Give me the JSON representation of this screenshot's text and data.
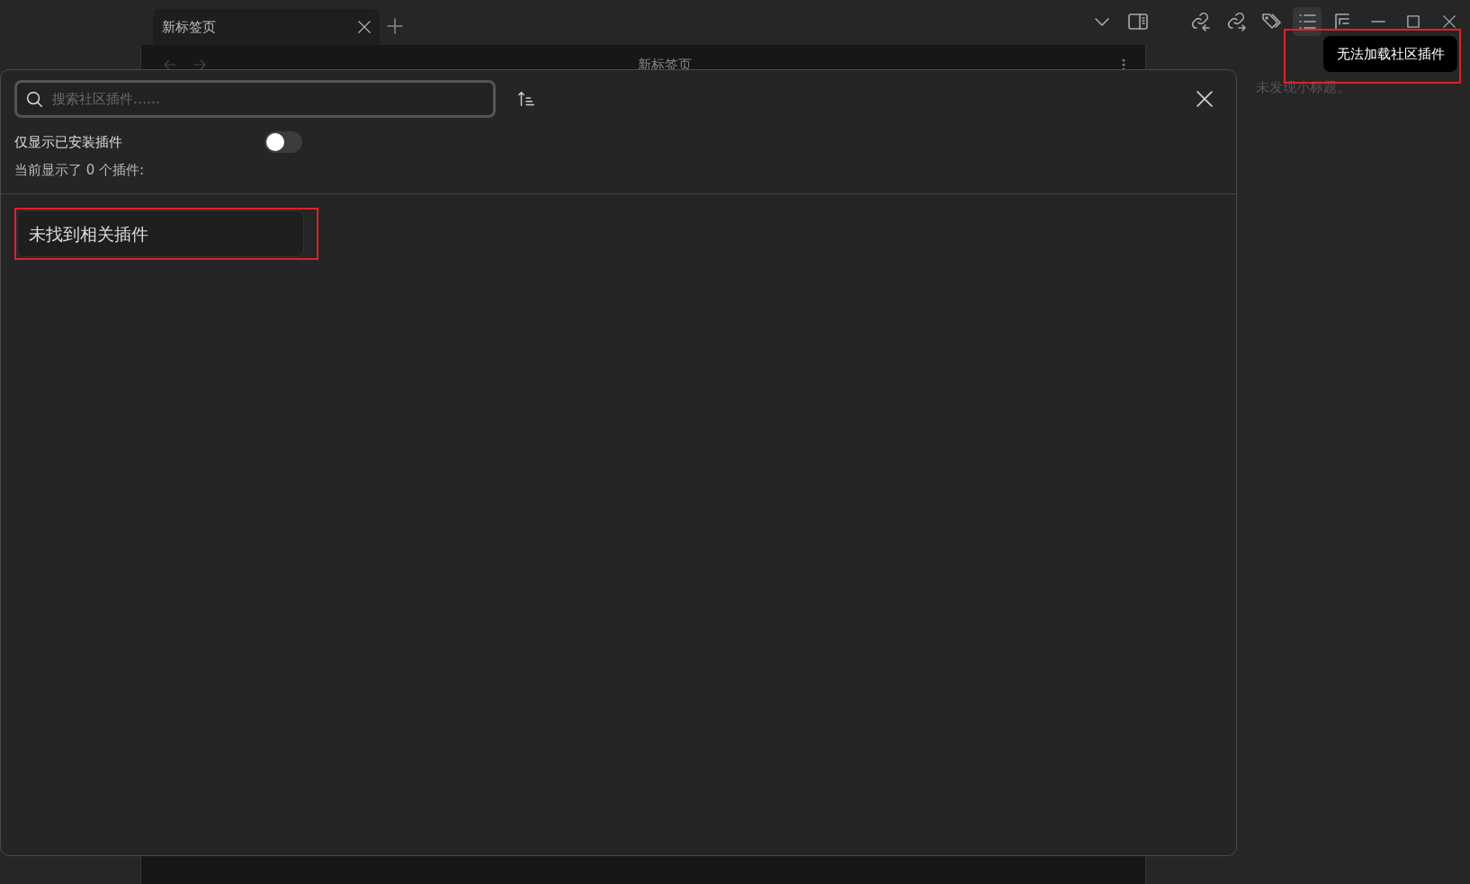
{
  "tabs": [
    {
      "label": "新标签页",
      "selected": true
    }
  ],
  "toolbar_buttons": [
    {
      "kind": "tab-list",
      "active": false
    },
    {
      "kind": "sidebar",
      "active": false
    },
    {
      "kind": "backlinks",
      "active": false
    },
    {
      "kind": "outlinks",
      "active": false
    },
    {
      "kind": "tags",
      "active": false
    },
    {
      "kind": "outline",
      "active": true
    },
    {
      "kind": "file-tree",
      "active": false
    },
    {
      "kind": "minimize",
      "active": false
    },
    {
      "kind": "maximize",
      "active": false
    },
    {
      "kind": "close",
      "active": false
    }
  ],
  "editor": {
    "title": "新标签页"
  },
  "outline_pane": {
    "empty_text": "未发现小标题。"
  },
  "modal": {
    "search": {
      "placeholder": "搜索社区插件……"
    },
    "installed_only": {
      "label": "仅显示已安装插件",
      "on": false
    },
    "count_text": "当前显示了 0 个插件:",
    "empty_message": {
      "text": "未找到相关插件",
      "highlighted": true
    }
  },
  "tooltip": {
    "text": "无法加载社区插件",
    "highlighted": true
  }
}
